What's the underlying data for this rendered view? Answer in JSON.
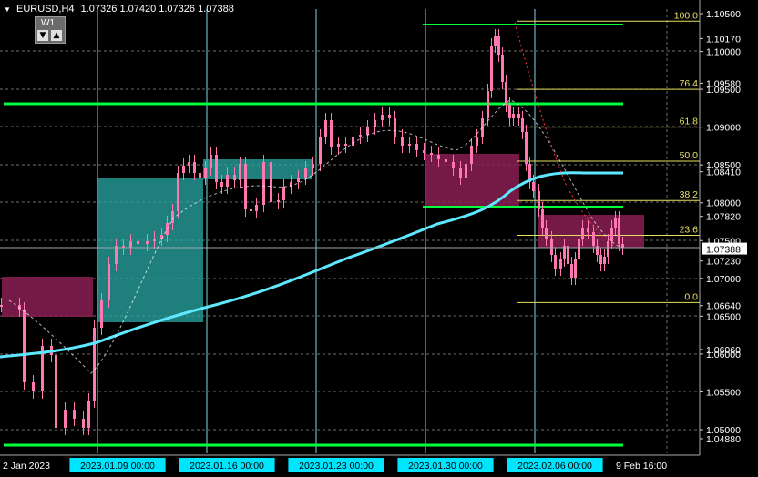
{
  "window": {
    "symbol_title": "EURUSD,H4",
    "ohlc": "1.07326 1.07420 1.07326 1.07388"
  },
  "timeframe": {
    "label": "W1",
    "down_icon": "▼",
    "up_icon": "▲"
  },
  "colors": {
    "background": "#000000",
    "candle": "#ff79b0",
    "fib": "#e8e060",
    "green_line": "#00ff3c",
    "ma": "#5ee8ff",
    "box_teal": "#2aa9a6",
    "box_magenta": "#8a1f53",
    "grid": "#6e6e6e",
    "vline": "#7fd6e6",
    "axis_text": "#ffffff",
    "label_bg": "#00e5ff"
  },
  "price_axis": {
    "labels": [
      "1.10500",
      "1.10170",
      "1.10000",
      "1.09580",
      "1.09500",
      "1.09000",
      "1.08500",
      "1.08410",
      "1.08000",
      "1.07820",
      "1.07500",
      "1.07388",
      "1.07230",
      "1.07000",
      "1.06640",
      "1.06500",
      "1.06060",
      "1.06000",
      "1.05500",
      "1.05000",
      "1.04880"
    ],
    "current": "1.07388"
  },
  "time_axis": {
    "labels": [
      {
        "text": "2 Jan 2023",
        "highlight": false
      },
      {
        "text": "2023.01.09 00:00",
        "highlight": true
      },
      {
        "text": "2023.01.16 00:00",
        "highlight": true
      },
      {
        "text": "2023.01.23 00:00",
        "highlight": true
      },
      {
        "text": "2023.01.30 00:00",
        "highlight": true
      },
      {
        "text": "2023.02.06 00:00",
        "highlight": true
      },
      {
        "text": "9 Feb 16:00",
        "highlight": false
      }
    ]
  },
  "fibonacci": {
    "levels": [
      {
        "label": "100.0",
        "price": 1.104
      },
      {
        "label": "76.4",
        "price": 1.095
      },
      {
        "label": "61.8",
        "price": 1.09
      },
      {
        "label": "50.0",
        "price": 1.0855
      },
      {
        "label": "38.2",
        "price": 1.0803
      },
      {
        "label": "23.6",
        "price": 1.0757
      },
      {
        "label": "0.0",
        "price": 1.0668
      }
    ]
  }
}
